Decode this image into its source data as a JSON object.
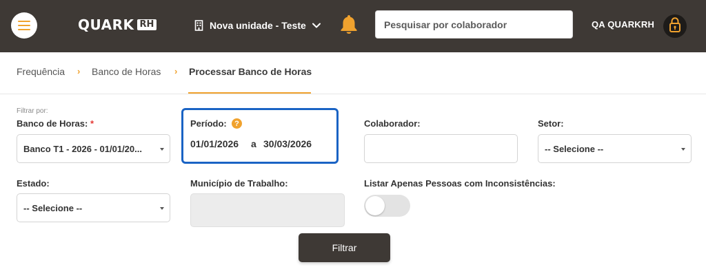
{
  "topbar": {
    "logo_text": "QUARK",
    "logo_badge": "RH",
    "unit_name": "Nova unidade - Teste",
    "search_placeholder": "Pesquisar por colaborador",
    "user_name": "QA QUARKRH"
  },
  "breadcrumb": {
    "items": [
      "Frequência",
      "Banco de Horas",
      "Processar Banco de Horas"
    ],
    "separator": "›"
  },
  "form": {
    "filter_by_label": "Filtrar por:",
    "banco": {
      "label": "Banco de Horas:",
      "required_mark": "*",
      "value": "Banco T1 - 2026 - 01/01/20..."
    },
    "periodo": {
      "label": "Período:",
      "help_glyph": "?",
      "start": "01/01/2026",
      "connector": "a",
      "end": "30/03/2026"
    },
    "colaborador": {
      "label": "Colaborador:",
      "value": ""
    },
    "setor": {
      "label": "Setor:",
      "value": "-- Selecione --"
    },
    "estado": {
      "label": "Estado:",
      "value": "-- Selecione --"
    },
    "municipio": {
      "label": "Município de Trabalho:",
      "value": ""
    },
    "inconsistencias": {
      "label": "Listar Apenas Pessoas com Inconsistências:",
      "enabled": false
    },
    "submit_label": "Filtrar"
  },
  "colors": {
    "header_bg": "#3e3935",
    "accent": "#f0a22e",
    "highlight_border": "#1a63c4",
    "required": "#e53935"
  },
  "icons": [
    "menu-icon",
    "building-icon",
    "chevron-down-icon",
    "bell-icon",
    "lock-icon",
    "help-icon",
    "caret-down-icon"
  ]
}
